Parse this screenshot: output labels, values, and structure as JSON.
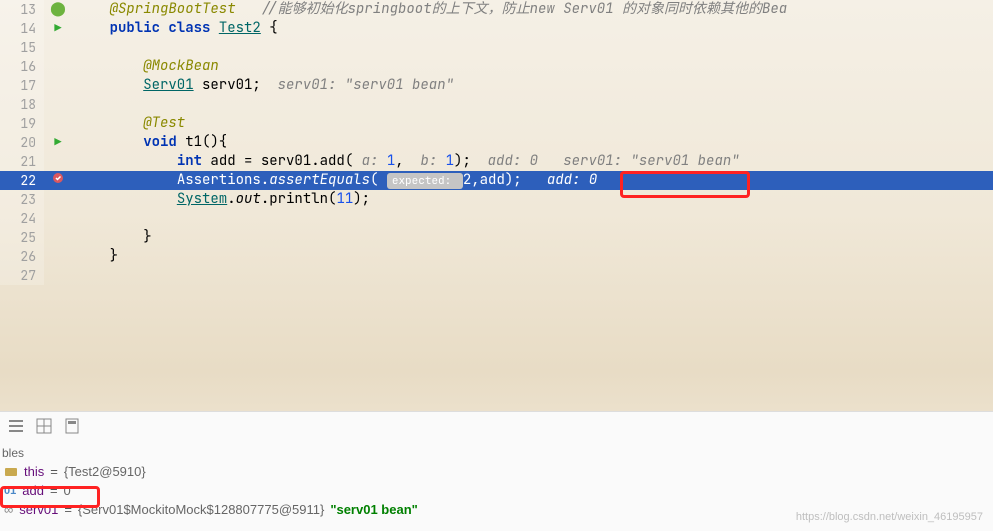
{
  "editor": {
    "lines": [
      {
        "num": "13",
        "marker": "spring",
        "segs": [
          {
            "cls": "",
            "t": "    "
          },
          {
            "cls": "anno",
            "t": "@SpringBootTest"
          },
          {
            "cls": "",
            "t": "   "
          },
          {
            "cls": "comment",
            "t": "//能够初始化springboot的上下文，防止new Serv01 的对象同时依赖其他的Bea"
          }
        ]
      },
      {
        "num": "14",
        "marker": "run",
        "segs": [
          {
            "cls": "",
            "t": "    "
          },
          {
            "cls": "kw",
            "t": "public class "
          },
          {
            "cls": "cls",
            "t": "Test2"
          },
          {
            "cls": "",
            "t": " {"
          }
        ]
      },
      {
        "num": "15",
        "marker": "",
        "segs": [
          {
            "cls": "",
            "t": "    "
          }
        ]
      },
      {
        "num": "16",
        "marker": "",
        "segs": [
          {
            "cls": "",
            "t": "        "
          },
          {
            "cls": "anno",
            "t": "@MockBean"
          }
        ]
      },
      {
        "num": "17",
        "marker": "",
        "segs": [
          {
            "cls": "",
            "t": "        "
          },
          {
            "cls": "cls",
            "t": "Serv01"
          },
          {
            "cls": "",
            "t": " serv01;  "
          },
          {
            "cls": "comment",
            "t": "serv01: \"serv01 bean\""
          }
        ]
      },
      {
        "num": "18",
        "marker": "",
        "segs": [
          {
            "cls": "",
            "t": ""
          }
        ]
      },
      {
        "num": "19",
        "marker": "",
        "segs": [
          {
            "cls": "",
            "t": "        "
          },
          {
            "cls": "anno",
            "t": "@Test"
          }
        ]
      },
      {
        "num": "20",
        "marker": "run",
        "segs": [
          {
            "cls": "",
            "t": "        "
          },
          {
            "cls": "kw",
            "t": "void "
          },
          {
            "cls": "",
            "t": "t1(){"
          }
        ]
      },
      {
        "num": "21",
        "marker": "",
        "segs": [
          {
            "cls": "",
            "t": "            "
          },
          {
            "cls": "kw",
            "t": "int "
          },
          {
            "cls": "",
            "t": "add = serv01.add( "
          },
          {
            "cls": "param",
            "t": "a: "
          },
          {
            "cls": "num",
            "t": "1"
          },
          {
            "cls": "",
            "t": ",  "
          },
          {
            "cls": "param",
            "t": "b: "
          },
          {
            "cls": "num",
            "t": "1"
          },
          {
            "cls": "",
            "t": ");  "
          },
          {
            "cls": "comment",
            "t": "add: 0   serv01: \"serv01 bean\""
          }
        ]
      },
      {
        "num": "22",
        "marker": "bp",
        "selected": true,
        "segs": [
          {
            "cls": "",
            "t": "            "
          },
          {
            "cls": "",
            "t": "Assertions."
          },
          {
            "cls": "method",
            "t": "assertEquals"
          },
          {
            "cls": "",
            "t": "( "
          },
          {
            "cls": "badge",
            "t": "expected: "
          },
          {
            "cls": "num",
            "t": "2"
          },
          {
            "cls": "",
            "t": ",add);   "
          },
          {
            "cls": "comment",
            "t": "add: 0"
          }
        ]
      },
      {
        "num": "23",
        "marker": "",
        "segs": [
          {
            "cls": "",
            "t": "            "
          },
          {
            "cls": "cls",
            "t": "System"
          },
          {
            "cls": "",
            "t": "."
          },
          {
            "cls": "method",
            "t": "out"
          },
          {
            "cls": "",
            "t": ".println("
          },
          {
            "cls": "num",
            "t": "11"
          },
          {
            "cls": "",
            "t": ");"
          }
        ]
      },
      {
        "num": "24",
        "marker": "",
        "segs": [
          {
            "cls": "",
            "t": ""
          }
        ]
      },
      {
        "num": "25",
        "marker": "",
        "segs": [
          {
            "cls": "",
            "t": "        }"
          }
        ]
      },
      {
        "num": "26",
        "marker": "",
        "segs": [
          {
            "cls": "",
            "t": "    }"
          }
        ]
      },
      {
        "num": "27",
        "marker": "",
        "segs": [
          {
            "cls": "",
            "t": ""
          }
        ]
      }
    ]
  },
  "debug_panel": {
    "header": "bles",
    "vars": [
      {
        "icon": "obj",
        "name": "this",
        "eq": " = ",
        "val": "{Test2@5910}",
        "highlight": false
      },
      {
        "icon": "prim",
        "name": "add",
        "eq": " = ",
        "val": "0",
        "highlight": true
      },
      {
        "icon": "link",
        "name": "serv01",
        "eq": " = ",
        "val": "{Serv01$MockitoMock$128807775@5911}",
        "str": " \"serv01 bean\"",
        "highlight": false
      }
    ]
  },
  "watermark": "https://blog.csdn.net/weixin_46195957",
  "highlight_inline": "add: 0"
}
